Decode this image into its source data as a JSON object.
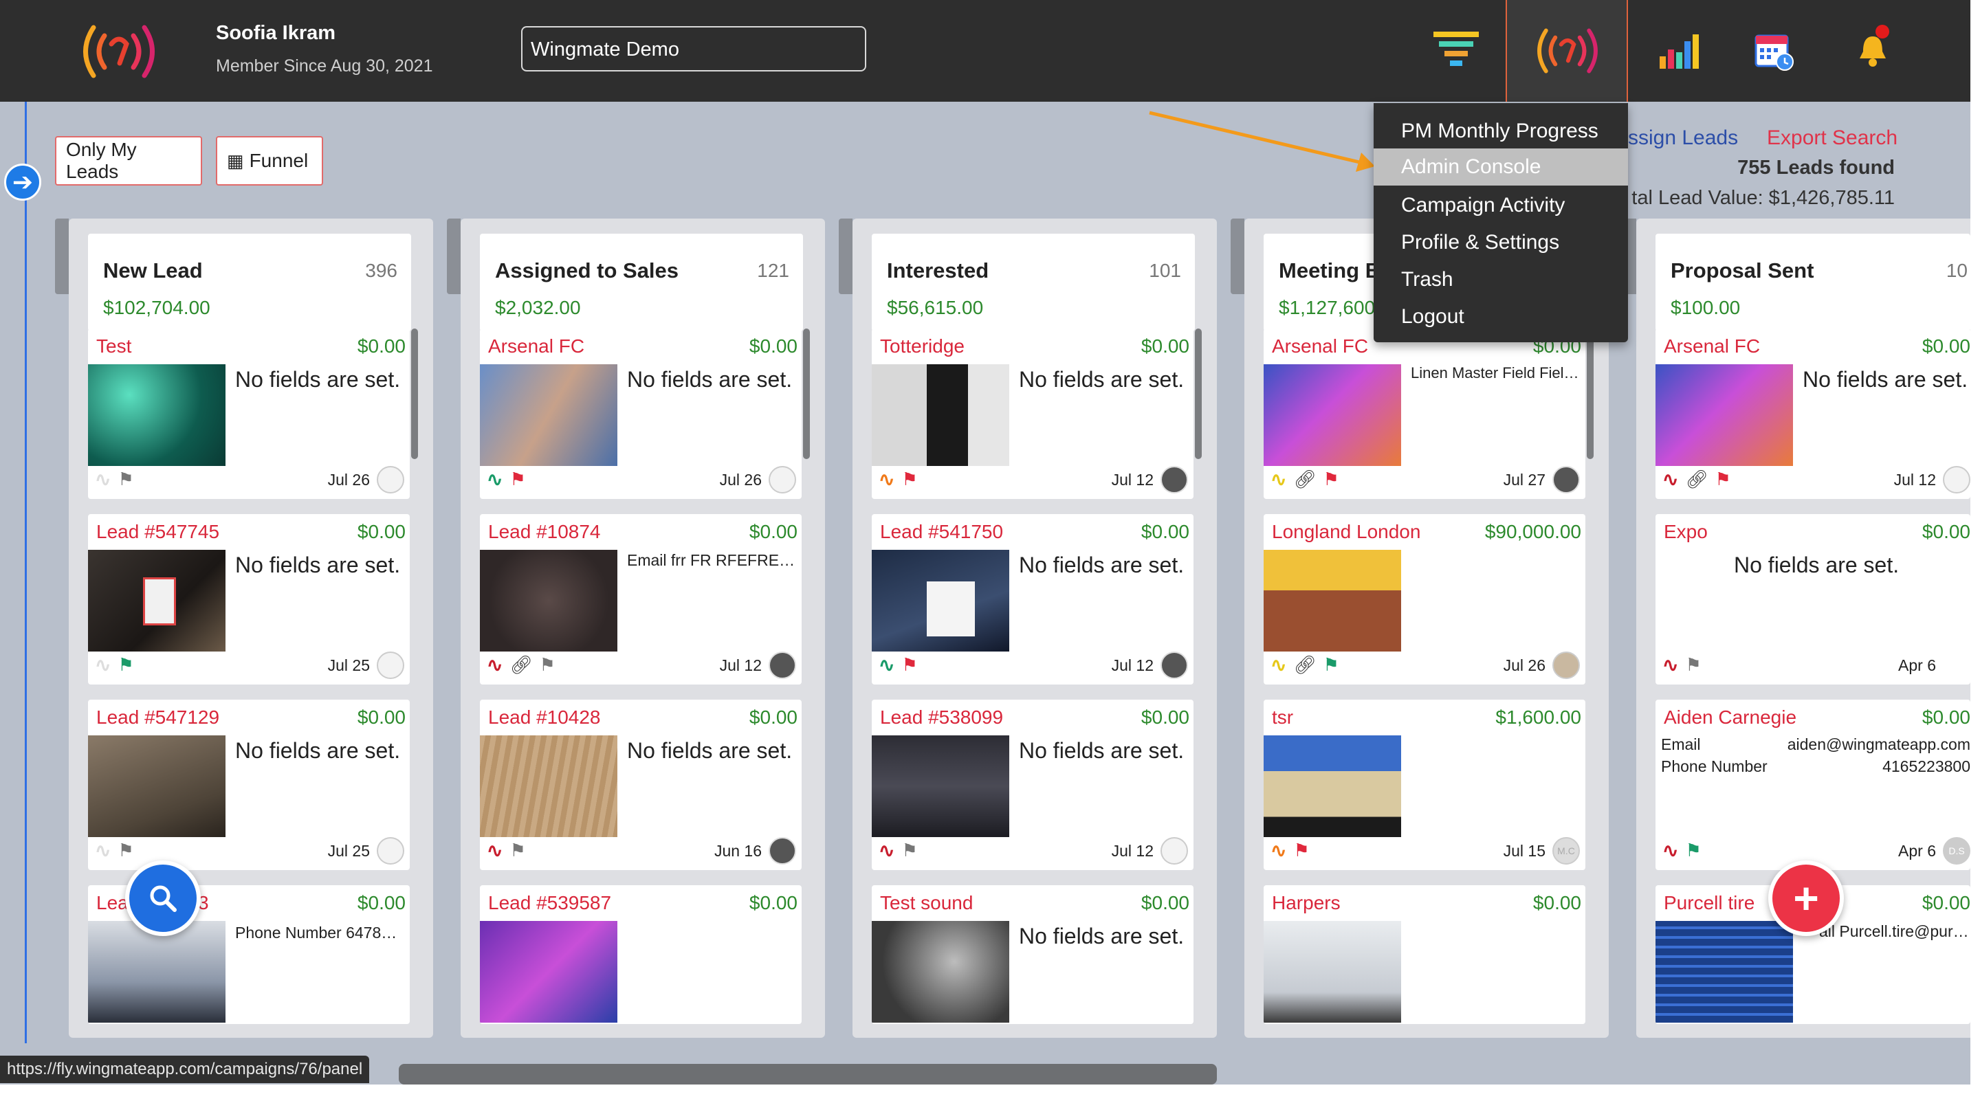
{
  "user": {
    "name": "Soofia Ikram",
    "since": "Member Since Aug 30, 2021"
  },
  "campaign": {
    "value": "Wingmate Demo"
  },
  "nav": {
    "icons": [
      "funnel-icon",
      "wingmate-logo-icon",
      "chart-icon",
      "calendar-icon",
      "bell-icon"
    ]
  },
  "filters": {
    "only_my_leads": "Only My Leads",
    "funnel": "Funnel"
  },
  "actions": {
    "assign_leads": "ssign Leads",
    "export_search": "Export Search"
  },
  "summary": {
    "leads_found": "755 Leads found",
    "total_value": "tal Lead Value: $1,426,785.11"
  },
  "menu": {
    "items": [
      "PM Monthly Progress",
      "Admin Console",
      "Campaign Activity",
      "Profile & Settings",
      "Trash",
      "Logout"
    ],
    "highlighted": "Admin Console"
  },
  "columns": [
    {
      "title": "New Lead",
      "count": "396",
      "value": "$102,704.00",
      "cards": [
        {
          "name": "Test",
          "value": "$0.00",
          "text": "No fields are set.",
          "date": "Jul 26"
        },
        {
          "name": "Lead #547745",
          "value": "$0.00",
          "text": "No fields are set.",
          "date": "Jul 25"
        },
        {
          "name": "Lead #547129",
          "value": "$0.00",
          "text": "No fields are set.",
          "date": "Jul 25"
        },
        {
          "name": "Lea",
          "name_tail": "3",
          "value": "$0.00",
          "text": "Phone Number  64786…",
          "date": ""
        }
      ]
    },
    {
      "title": "Assigned to Sales",
      "count": "121",
      "value": "$2,032.00",
      "cards": [
        {
          "name": "Arsenal FC",
          "value": "$0.00",
          "text": "No fields are set.",
          "date": "Jul 26"
        },
        {
          "name": "Lead #10874",
          "value": "$0.00",
          "text": "Email  frr FR RFEFRE F…",
          "date": "Jul 12"
        },
        {
          "name": "Lead #10428",
          "value": "$0.00",
          "text": "No fields are set.",
          "date": "Jun 16"
        },
        {
          "name": "Lead #539587",
          "value": "$0.00",
          "text": "",
          "date": ""
        }
      ]
    },
    {
      "title": "Interested",
      "count": "101",
      "value": "$56,615.00",
      "cards": [
        {
          "name": "Totteridge",
          "value": "$0.00",
          "text": "No fields are set.",
          "date": "Jul 12"
        },
        {
          "name": "Lead #541750",
          "value": "$0.00",
          "text": "No fields are set.",
          "date": "Jul 12"
        },
        {
          "name": "Lead #538099",
          "value": "$0.00",
          "text": "No fields are set.",
          "date": "Jul 12"
        },
        {
          "name": "Test sound",
          "value": "$0.00",
          "text": "No fields are set.",
          "date": ""
        }
      ]
    },
    {
      "title": "Meeting B",
      "count": "",
      "value": "$1,127,600",
      "cards": [
        {
          "name": "Arsenal FC",
          "value": "$0.00",
          "text": "Linen Master Field  Fiel…",
          "date": "Jul 27"
        },
        {
          "name": "Longland London",
          "value": "$90,000.00",
          "text": "",
          "date": "Jul 26"
        },
        {
          "name": "tsr",
          "value": "$1,600.00",
          "text": "",
          "date": "Jul 15"
        },
        {
          "name": "Harpers",
          "value": "$0.00",
          "text": "",
          "date": ""
        }
      ]
    },
    {
      "title": "Proposal Sent",
      "count": "10",
      "value": "$100.00",
      "cards": [
        {
          "name": "Arsenal FC",
          "value": "$0.00",
          "text": "No fields are set.",
          "date": "Jul 12"
        },
        {
          "name": "Expo",
          "value": "$0.00",
          "text": "No fields are set.",
          "date": "Apr 6"
        },
        {
          "name": "Aiden Carnegie",
          "value": "$0.00",
          "email_label": "Email",
          "email": "aiden@wingmateapp.com",
          "phone_label": "Phone Number",
          "phone": "4165223800",
          "date": "Apr 6",
          "avatar": "D.S"
        },
        {
          "name": "Purcell tire",
          "value": "$0.00",
          "text": "ail  Purcell.tire@pur…",
          "date": ""
        }
      ]
    }
  ],
  "avatar_labels": {
    "tsr": "M.C"
  },
  "status": {
    "url": "https://fly.wingmateapp.com/campaigns/76/panel"
  },
  "colors": {
    "topbar": "#2e2e2e",
    "board": "#b8bfcb",
    "lead_name": "#d9273b",
    "money": "#2d8a2d",
    "accent": "#e0623c"
  }
}
